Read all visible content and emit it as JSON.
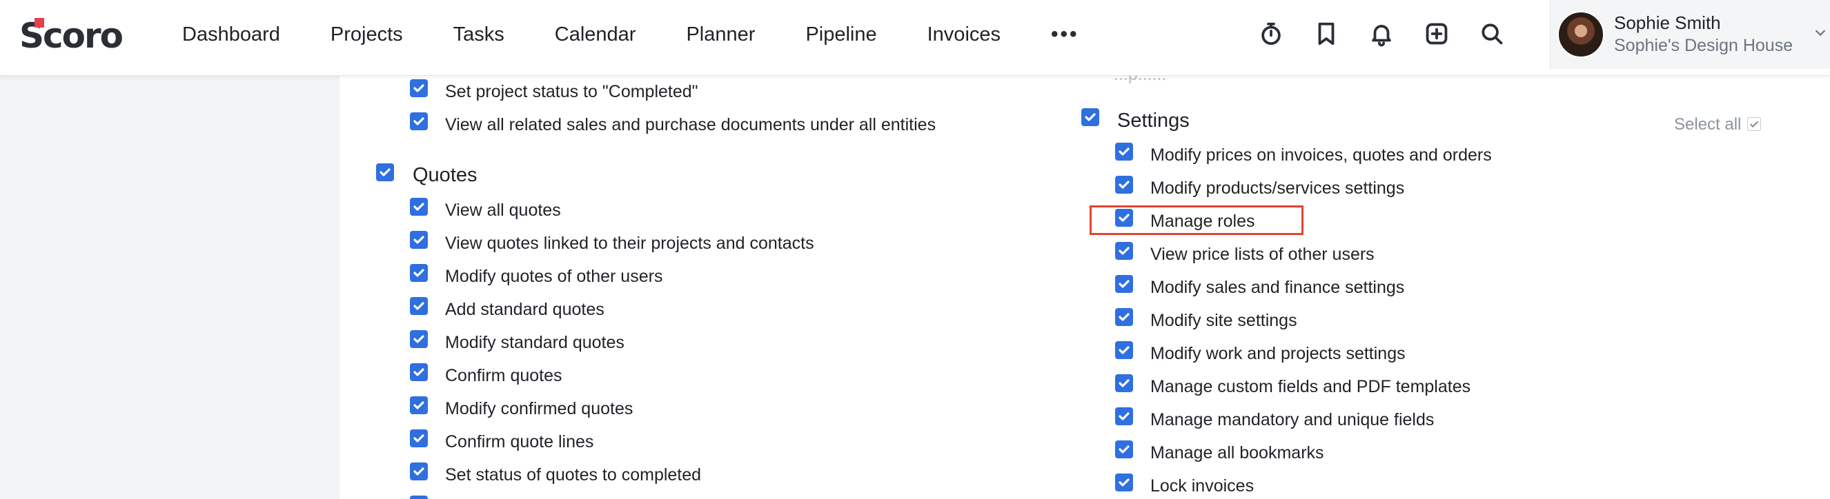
{
  "app": {
    "logo": "Scoro"
  },
  "nav": {
    "items": [
      "Dashboard",
      "Projects",
      "Tasks",
      "Calendar",
      "Planner",
      "Pipeline",
      "Invoices"
    ],
    "more": "•••"
  },
  "toolbar": {
    "icons": [
      "timer-icon",
      "bookmark-icon",
      "bell-icon",
      "add-icon",
      "search-icon"
    ]
  },
  "user": {
    "name": "Sophie Smith",
    "organization": "Sophie's Design House"
  },
  "left_column": {
    "top_items": [
      "Set project status to \"Completed\"",
      "View all related sales and purchase documents under all entities"
    ],
    "quotes": {
      "title": "Quotes",
      "items": [
        "View all quotes",
        "View quotes linked to their projects and contacts",
        "Modify quotes of other users",
        "Add standard quotes",
        "Modify standard quotes",
        "Confirm quotes",
        "Modify confirmed quotes",
        "Confirm quote lines",
        "Set status of quotes to completed"
      ]
    }
  },
  "right_column": {
    "cut_off_text": "...p......",
    "settings": {
      "title": "Settings",
      "select_all": "Select all",
      "items": [
        "Modify prices on invoices, quotes and orders",
        "Modify products/services settings",
        "Manage roles",
        "View price lists of other users",
        "Modify sales and finance settings",
        "Modify site settings",
        "Modify work and projects settings",
        "Manage custom fields and PDF templates",
        "Manage mandatory and unique fields",
        "Manage all bookmarks",
        "Lock invoices"
      ],
      "highlighted_item": "Manage roles"
    }
  },
  "colors": {
    "checkbox": "#2f6fe0",
    "highlight": "#e2432f",
    "brand_accent": "#e2434b"
  }
}
